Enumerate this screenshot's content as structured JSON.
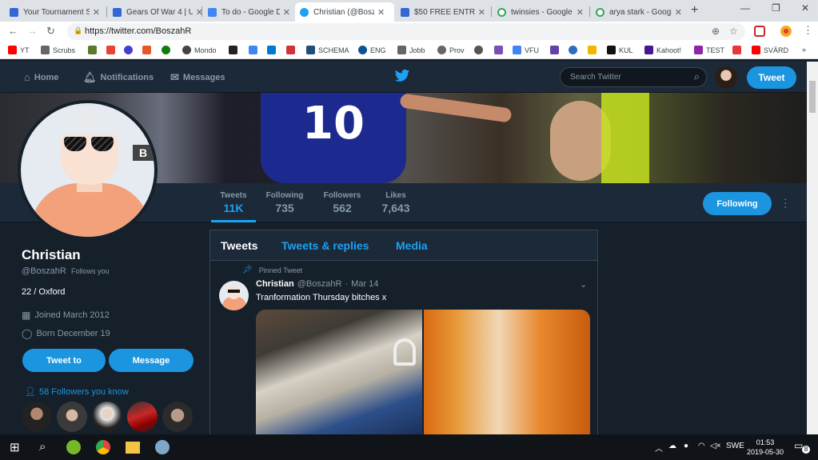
{
  "browser": {
    "tabs": [
      {
        "title": "Your Tournament S",
        "color": "#3367d6",
        "active": false
      },
      {
        "title": "Gears Of War 4 | U",
        "color": "#3367d6",
        "active": false
      },
      {
        "title": "To do - Google Do",
        "color": "#4285f4",
        "active": false
      },
      {
        "title": "Christian (@Boszah",
        "color": "#1da1f2",
        "active": true
      },
      {
        "title": "$50 FREE ENTRY T",
        "color": "#3367d6",
        "active": false
      },
      {
        "title": "twinsies - Google",
        "color": "#34a853",
        "active": false
      },
      {
        "title": "arya stark - Google",
        "color": "#34a853",
        "active": false
      }
    ],
    "new_tab": "+",
    "url": "https://twitter.com/BoszahR",
    "bookmarks": [
      {
        "label": "YT",
        "color": "#ff0000"
      },
      {
        "label": "Scrubs",
        "color": "#666666"
      },
      {
        "label": "",
        "color": "#5a7a2a"
      },
      {
        "label": "",
        "color": "#ea4335"
      },
      {
        "label": "",
        "color": "#4a3bd1"
      },
      {
        "label": "",
        "color": "#e8582d"
      },
      {
        "label": "",
        "color": "#107c10"
      },
      {
        "label": "Mondo",
        "color": "#444444"
      },
      {
        "label": "",
        "color": "#222222"
      },
      {
        "label": "",
        "color": "#4285f4"
      },
      {
        "label": "",
        "color": "#0078d4"
      },
      {
        "label": "",
        "color": "#d13438"
      },
      {
        "label": "SCHEMA",
        "color": "#1f4e79"
      },
      {
        "label": "ENG",
        "color": "#0b5394"
      },
      {
        "label": "Jobb",
        "color": "#666666"
      },
      {
        "label": "Prov",
        "color": "#666666"
      },
      {
        "label": "",
        "color": "#555555"
      },
      {
        "label": "",
        "color": "#7a4fb8"
      },
      {
        "label": "VFU",
        "color": "#4285f4"
      },
      {
        "label": "",
        "color": "#6441a5"
      },
      {
        "label": "",
        "color": "#2c6ebd"
      },
      {
        "label": "",
        "color": "#f4b400"
      },
      {
        "label": "KUL",
        "color": "#111111"
      },
      {
        "label": "Kahoot!",
        "color": "#46178f"
      },
      {
        "label": "TEST",
        "color": "#8e24aa"
      },
      {
        "label": "",
        "color": "#e53935"
      },
      {
        "label": "SVÄRD",
        "color": "#ff0000"
      }
    ],
    "bookmarks_more": "»"
  },
  "twitter_nav": {
    "home": "Home",
    "notifications": "Notifications",
    "messages": "Messages",
    "search_placeholder": "Search Twitter",
    "tweet_button": "Tweet"
  },
  "profile": {
    "name": "Christian",
    "handle": "@BoszahR",
    "follows_you": "Follows you",
    "bio": "22 / Oxford",
    "joined": "Joined March 2012",
    "born": "Born December 19",
    "tweet_to": "Tweet to",
    "message": "Message",
    "followers_you_know": "58 Followers you know",
    "badge_letter": "B"
  },
  "stats": [
    {
      "label": "Tweets",
      "value": "11K",
      "active": true
    },
    {
      "label": "Following",
      "value": "735",
      "active": false
    },
    {
      "label": "Followers",
      "value": "562",
      "active": false
    },
    {
      "label": "Likes",
      "value": "7,643",
      "active": false
    }
  ],
  "following_button": "Following",
  "timeline": {
    "tabs": [
      "Tweets",
      "Tweets & replies",
      "Media"
    ],
    "pinned_label": "Pinned Tweet",
    "tweet": {
      "name": "Christian",
      "handle": "@BoszahR",
      "sep": "·",
      "date": "Mar 14",
      "text": "Tranformation Thursday bitches x"
    }
  },
  "banner": {
    "jersey_number": "10"
  },
  "taskbar": {
    "lang": "SWE",
    "time": "01:53",
    "date": "2019-05-30",
    "notif_count": "8"
  }
}
